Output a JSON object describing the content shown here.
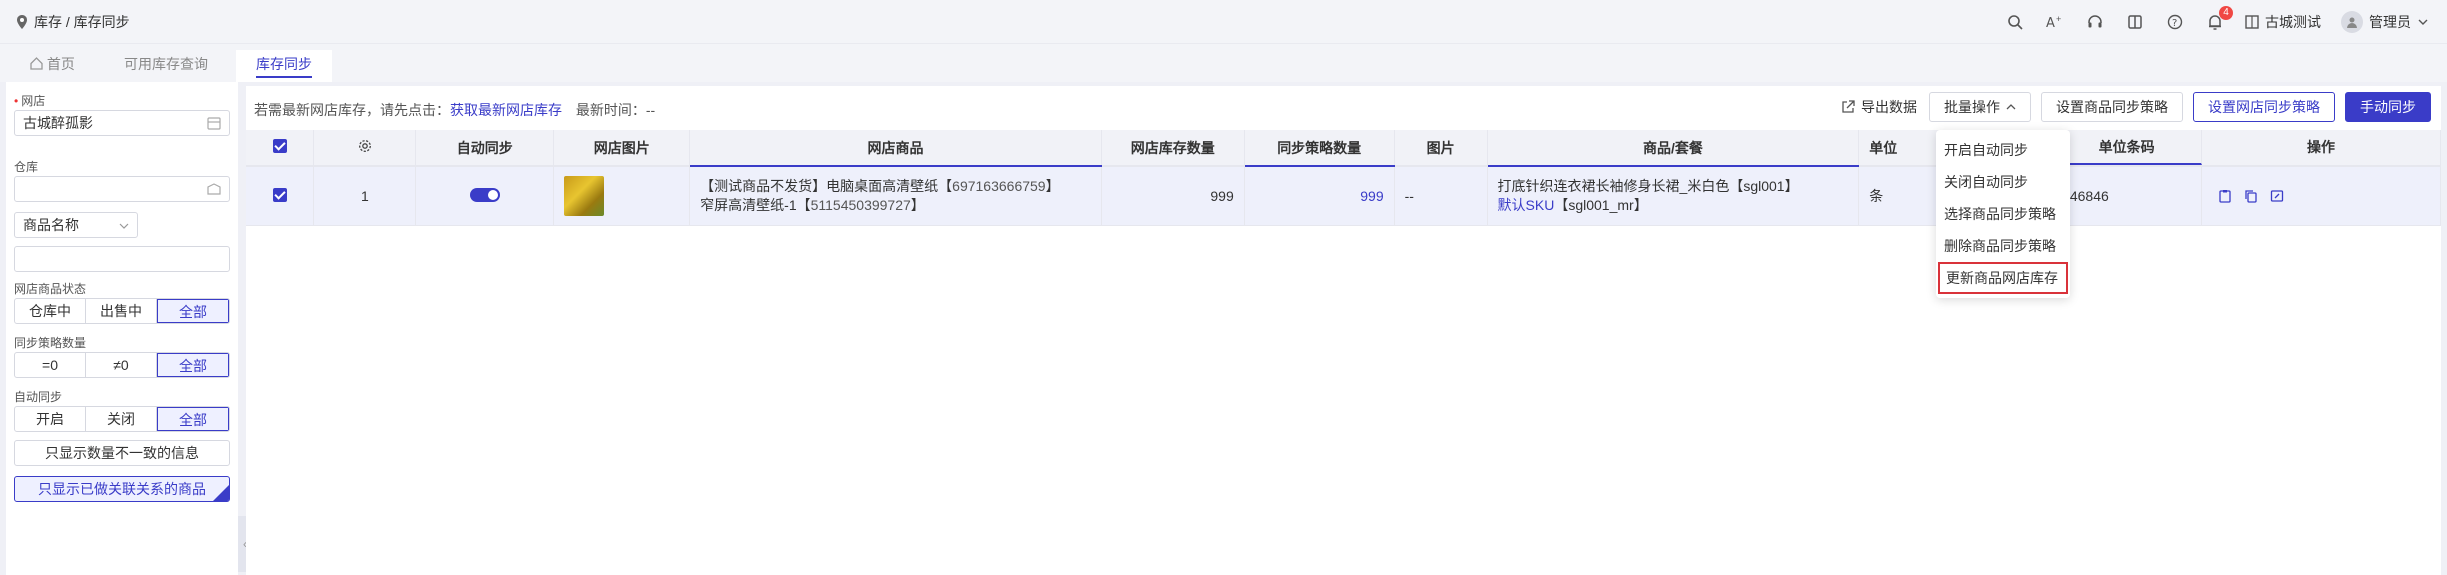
{
  "topbar": {
    "breadcrumb": "库存 / 库存同步",
    "shop": "古城测试",
    "user": "管理员",
    "notification_count": "4"
  },
  "tabs": [
    {
      "label": "首页"
    },
    {
      "label": "可用库存查询"
    },
    {
      "label": "库存同步"
    }
  ],
  "sidebar": {
    "shop_label": "网店",
    "shop_value": "古城醉孤影",
    "warehouse_label": "仓库",
    "product_select": "商品名称",
    "status_label": "网店商品状态",
    "status_options": [
      "仓库中",
      "出售中",
      "全部"
    ],
    "policy_label": "同步策略数量",
    "policy_options": [
      "=0",
      "≠0",
      "全部"
    ],
    "auto_label": "自动同步",
    "auto_options": [
      "开启",
      "关闭",
      "全部"
    ],
    "only_diff": "只显示数量不一致的信息",
    "only_linked": "只显示已做关联关系的商品"
  },
  "main": {
    "notice_prefix": "若需最新网店库存，请先点击：",
    "notice_link": "获取最新网店库存",
    "notice_time": "最新时间：--",
    "export": "导出数据",
    "batch": "批量操作",
    "set_product_policy": "设置商品同步策略",
    "set_shop_policy": "设置网店同步策略",
    "manual_sync": "手动同步"
  },
  "table": {
    "headers": [
      "自动同步",
      "网店图片",
      "网店商品",
      "网店库存数量",
      "同步策略数量",
      "图片",
      "商品/套餐",
      "单位",
      "单位条码",
      "操作"
    ],
    "row": {
      "index": "1",
      "shop_product_line1": "【测试商品不发货】电脑桌面高清壁纸【",
      "shop_product_id1": "697163666759",
      "shop_product_close1": "】",
      "shop_product_line2": "窄屏高清壁纸-1【",
      "shop_product_id2": "5115450399727",
      "shop_product_close2": "】",
      "shop_stock": "999",
      "policy_qty": "999",
      "image": "--",
      "goods_line1": "打底针织连衣裙长袖修身长裙_米白色【sgl001】",
      "goods_sku": "默认SKU",
      "goods_line2": "【sgl001_mr】",
      "unit": "条",
      "barcode": "346846"
    }
  },
  "dropdown": {
    "items": [
      "开启自动同步",
      "关闭自动同步",
      "选择商品同步策略",
      "删除商品同步策略",
      "更新商品网店库存"
    ]
  }
}
